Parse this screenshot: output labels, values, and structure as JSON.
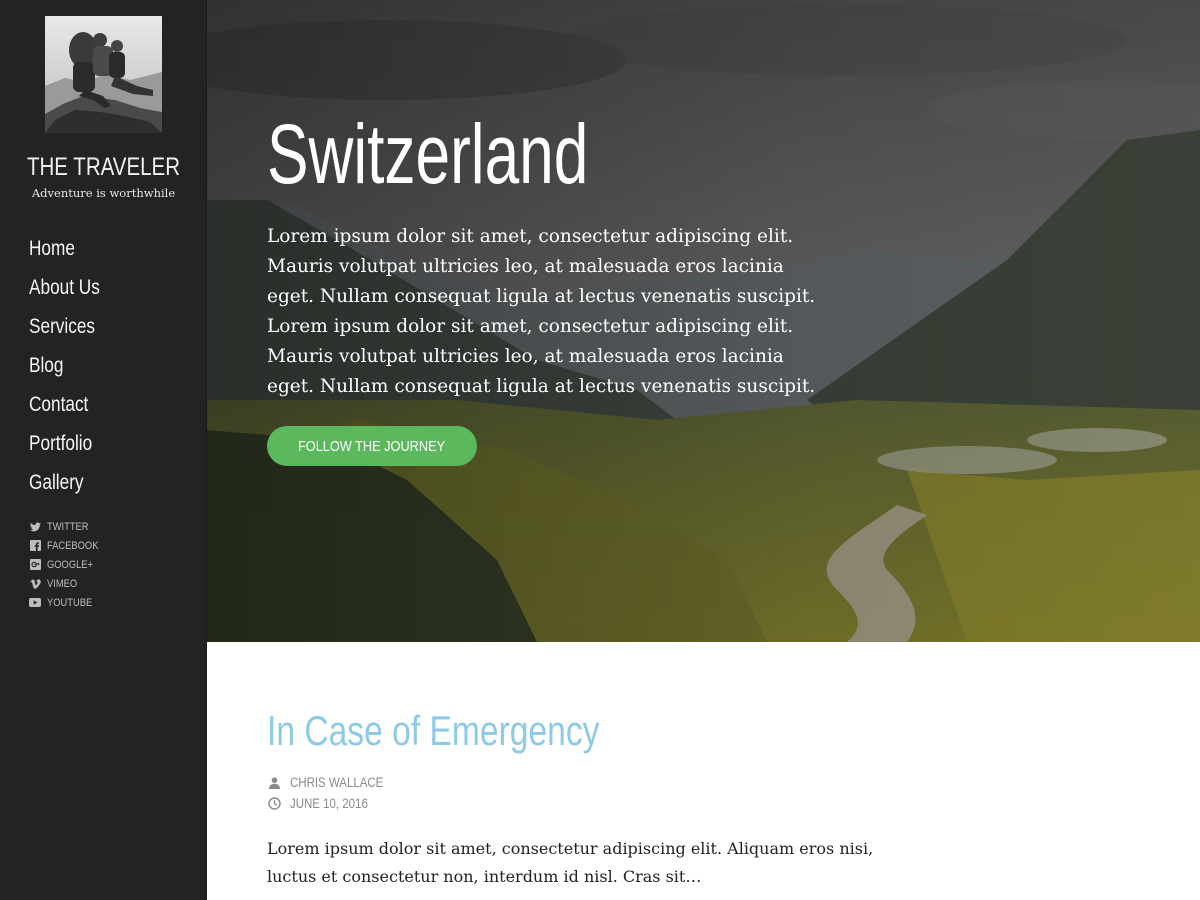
{
  "colors": {
    "sidebar_bg": "#232323",
    "accent_green": "#5cb85c",
    "post_title_blue": "#8ecae6",
    "meta_gray": "#8a8a8a"
  },
  "sidebar": {
    "site_title": "THE TRAVELER",
    "tagline": "Adventure is worthwhile",
    "nav": [
      {
        "label": "Home"
      },
      {
        "label": "About Us"
      },
      {
        "label": "Services"
      },
      {
        "label": "Blog"
      },
      {
        "label": "Contact"
      },
      {
        "label": "Portfolio"
      },
      {
        "label": "Gallery"
      }
    ],
    "social": [
      {
        "label": "TWITTER",
        "icon": "twitter-icon"
      },
      {
        "label": "FACEBOOK",
        "icon": "facebook-icon"
      },
      {
        "label": "GOOGLE+",
        "icon": "google-plus-icon"
      },
      {
        "label": "VIMEO",
        "icon": "vimeo-icon"
      },
      {
        "label": "YOUTUBE",
        "icon": "youtube-icon"
      }
    ]
  },
  "hero": {
    "title": "Switzerland",
    "text": "Lorem ipsum dolor sit amet, consectetur adipiscing elit. Mauris volutpat ultricies leo, at malesuada eros lacinia eget. Nullam consequat ligula at lectus venenatis suscipit. Lorem ipsum dolor sit amet, consectetur adipiscing elit. Mauris volutpat ultricies leo, at malesuada eros lacinia eget. Nullam consequat ligula at lectus venenatis suscipit.",
    "button_label": "FOLLOW THE JOURNEY"
  },
  "post": {
    "title": "In Case of Emergency",
    "author": "CHRIS WALLACE",
    "date": "JUNE 10, 2016",
    "excerpt": "Lorem ipsum dolor sit amet, consectetur adipiscing elit. Aliquam eros nisi, luctus et consectetur non, interdum id nisl. Cras sit…",
    "author_icon": "user-icon",
    "date_icon": "clock-icon"
  }
}
